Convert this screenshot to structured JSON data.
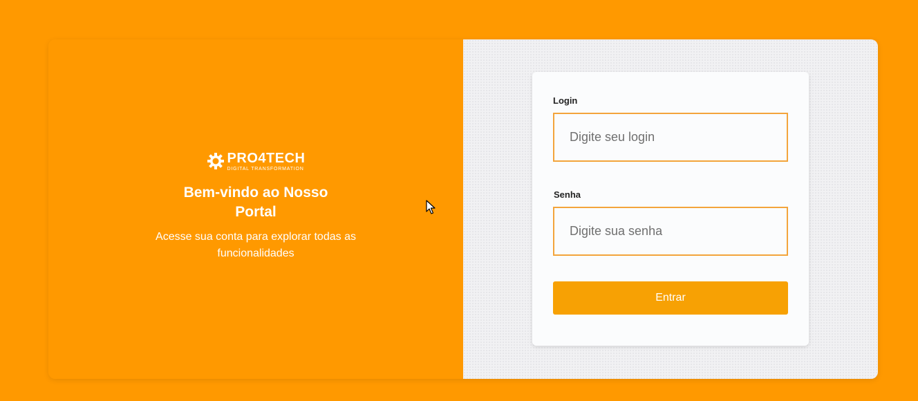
{
  "brand": {
    "logo_name": "PRO4TECH",
    "logo_tagline": "DIGITAL TRANSFORMATION",
    "logo_icon": "gear-icon",
    "welcome_title": "Bem-vindo ao Nosso Portal",
    "welcome_subtitle": "Acesse sua conta para explorar todas as funcionalidades"
  },
  "form": {
    "login_label": "Login",
    "login_placeholder": "Digite seu login",
    "login_value": "",
    "password_label": "Senha",
    "password_placeholder": "Digite sua senha",
    "password_value": "",
    "submit_label": "Entrar"
  },
  "colors": {
    "background": "#ff9900",
    "accent": "#f7a104",
    "input_border": "#f3a43b",
    "form_background": "#fbfcfd"
  },
  "cursor": {
    "icon": "mouse-pointer-icon"
  }
}
